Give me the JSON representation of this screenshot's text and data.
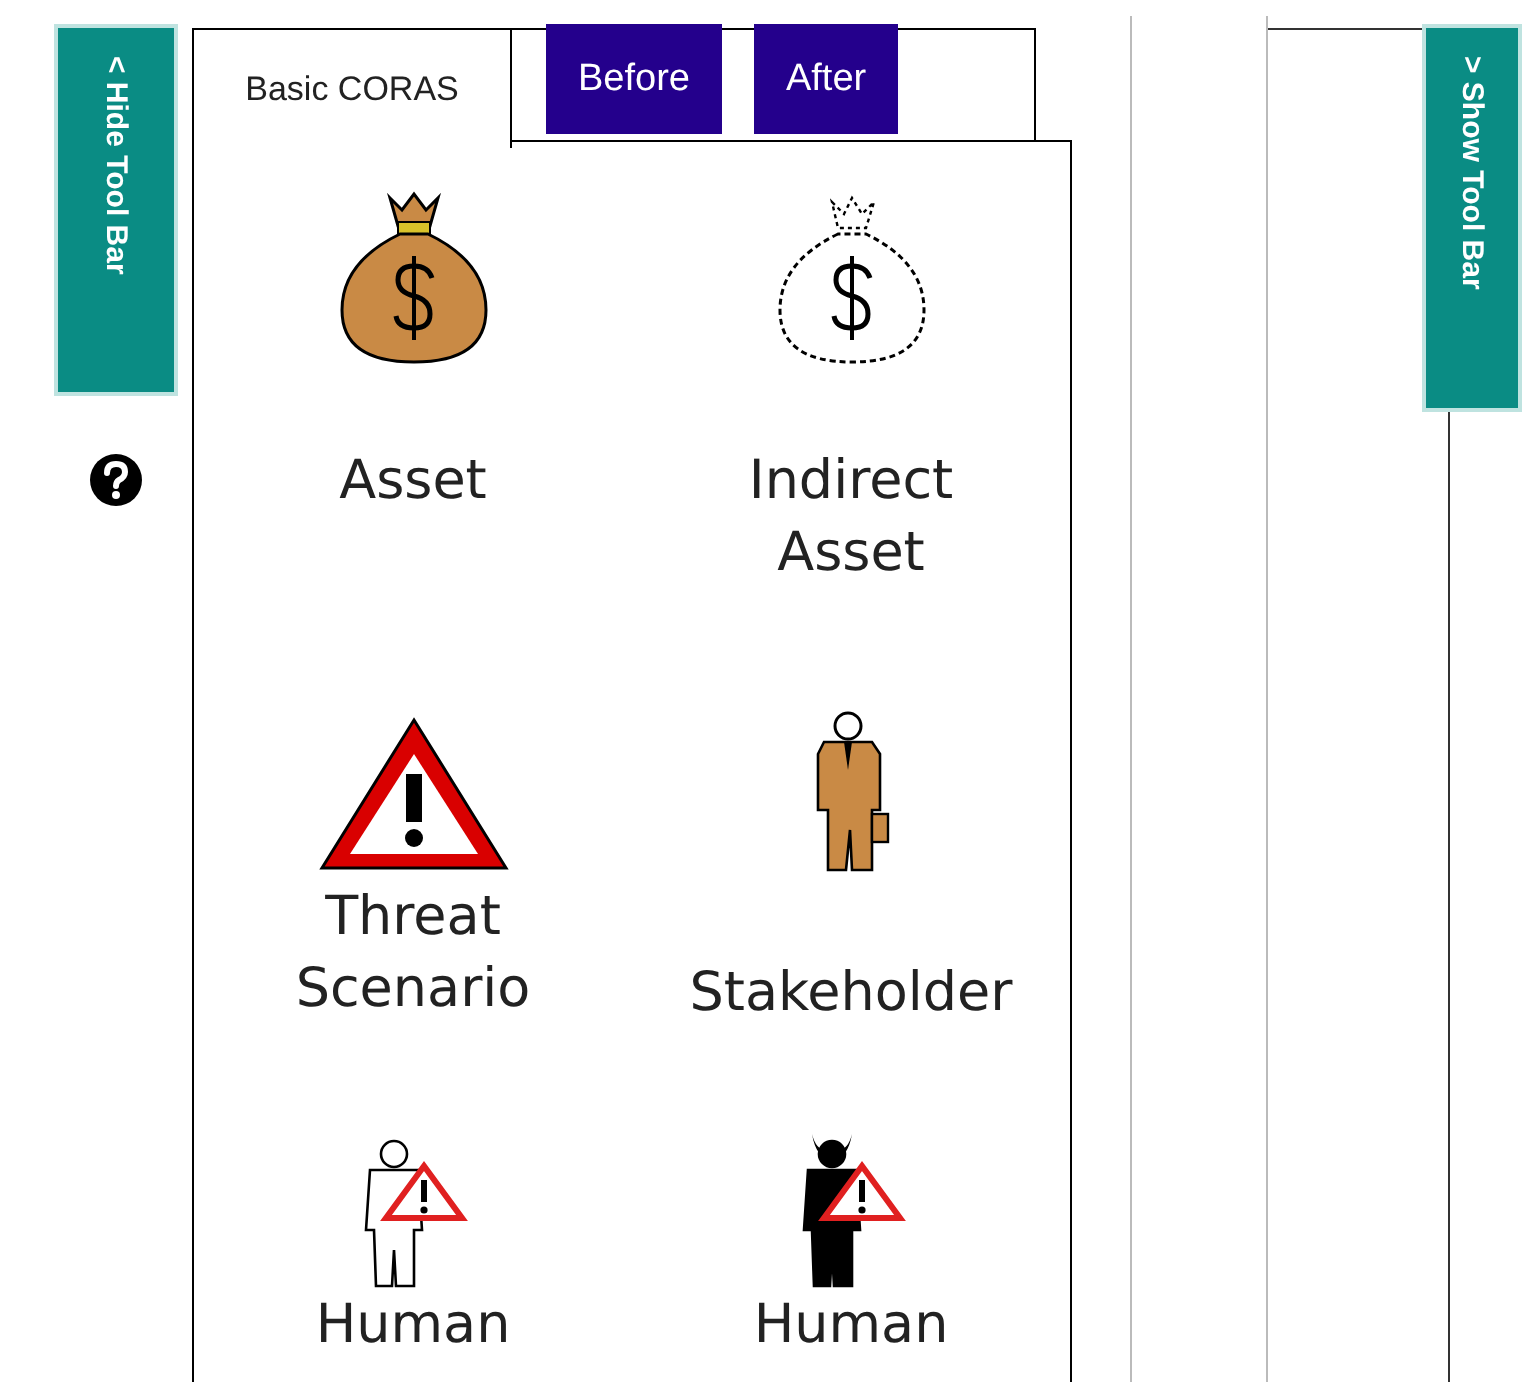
{
  "left_toggle": {
    "label": "< Hide Tool Bar"
  },
  "tabs": [
    {
      "label": "Basic CORAS",
      "selected": true
    },
    {
      "label": "Before",
      "selected": false
    },
    {
      "label": "After",
      "selected": false
    }
  ],
  "palette": [
    {
      "kind": "asset",
      "label": "Asset"
    },
    {
      "kind": "indirect_asset",
      "label": "Indirect Asset"
    },
    {
      "kind": "threat_scenario",
      "label": "Threat Scenario"
    },
    {
      "kind": "stakeholder",
      "label": "Stakeholder"
    },
    {
      "kind": "human_accidental",
      "label": "Human"
    },
    {
      "kind": "human_deliberate",
      "label": "Human"
    }
  ],
  "right_toggle": {
    "label": "> Show Tool Bar"
  }
}
